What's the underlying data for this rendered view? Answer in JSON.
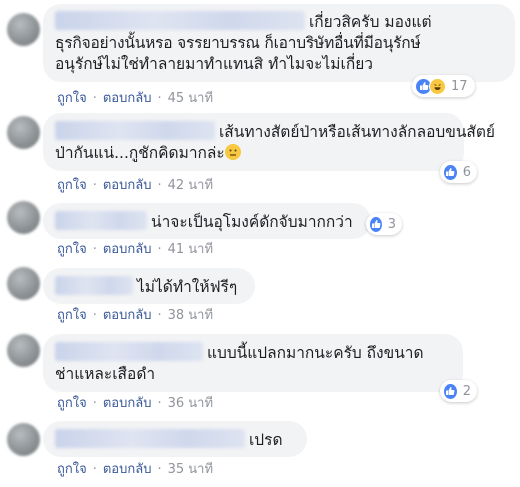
{
  "actions": {
    "like": "ถูกใจ",
    "reply": "ตอบกลับ",
    "separator": "·"
  },
  "comments": [
    {
      "lines": [
        "เกี่ยวสิครับ มองแต่",
        "ธุรกิจอย่างนั้นหรอ จรรยาบรรณ ก็เอาบริษัทอื่นที่มีอนุรักษ์",
        "อนุรักษ์ไม่ใช่ทำลายมาทำแทนสิ ทำไมจะไม่เกี่ยว"
      ],
      "time": "45 นาที",
      "reactions": {
        "icons": [
          "like-icon",
          "haha-icon"
        ],
        "count": "17"
      }
    },
    {
      "lines": [
        "เส้นทางสัตย์ป่าหรือเส้นทางลักลอบขนสัตย์",
        "ป่ากันแน่...กูชักคิดมากล่ะ"
      ],
      "inline_emoji": "neutral-face-emoji",
      "time": "42 นาที",
      "reactions": {
        "icons": [
          "like-icon"
        ],
        "count": "6"
      }
    },
    {
      "lines": [
        "น่าจะเป็นอุโมงค์ดักจับมากกว่า"
      ],
      "time": "41 นาที",
      "reactions": {
        "icons": [
          "like-icon"
        ],
        "count": "3"
      }
    },
    {
      "lines": [
        "ไม่ได้ทำให้ฟรีๆ"
      ],
      "time": "38 นาที"
    },
    {
      "lines": [
        "แบบนี้แปลกมากนะครับ ถึงขนาด",
        "ช่าแหละเสือดำ"
      ],
      "time": "36 นาที",
      "reactions": {
        "icons": [
          "like-icon"
        ],
        "count": "2"
      }
    },
    {
      "lines": [
        "เปรด"
      ],
      "time": "35 นาที"
    }
  ],
  "colors": {
    "link": "#385898",
    "muted": "#90949c",
    "bubble": "#f2f3f5",
    "like": "#4a83f5",
    "haha": "#f7c840"
  }
}
